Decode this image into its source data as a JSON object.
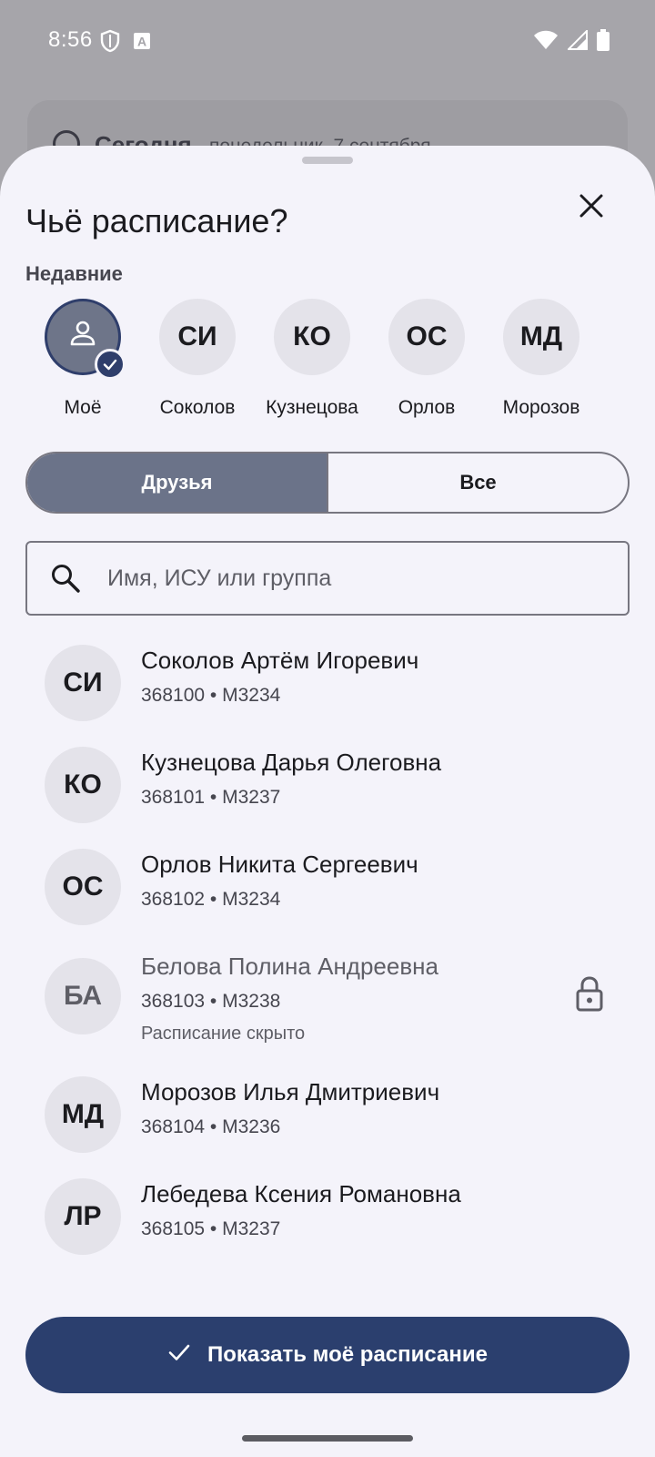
{
  "status_bar": {
    "time": "8:56",
    "icons": [
      "shield-icon",
      "font-a-icon",
      "wifi-icon",
      "signal-icon",
      "battery-icon"
    ]
  },
  "background": {
    "card_title": "Сегодня",
    "card_subtitle": "понедельник, 7 сентября"
  },
  "sheet": {
    "title": "Чьё расписание?",
    "close_icon": "close-icon",
    "recent_label": "Недавние",
    "recent": [
      {
        "initials": "",
        "name": "Моё",
        "selected": true,
        "icon": "person-icon"
      },
      {
        "initials": "СИ",
        "name": "Соколов",
        "selected": false
      },
      {
        "initials": "КО",
        "name": "Кузнецова",
        "selected": false
      },
      {
        "initials": "ОС",
        "name": "Орлов",
        "selected": false
      },
      {
        "initials": "МД",
        "name": "Морозов",
        "selected": false
      }
    ],
    "segments": {
      "friends": "Друзья",
      "all": "Все",
      "active": "friends"
    },
    "search": {
      "placeholder": "Имя, ИСУ или группа",
      "value": ""
    },
    "people": [
      {
        "initials": "СИ",
        "name": "Соколов Артём Игоревич",
        "meta": "368100 • M3234"
      },
      {
        "initials": "КО",
        "name": "Кузнецова Дарья Олеговна",
        "meta": "368101 • M3237"
      },
      {
        "initials": "ОС",
        "name": "Орлов Никита Сергеевич",
        "meta": "368102 • M3234"
      },
      {
        "initials": "БА",
        "name": "Белова Полина Андреевна",
        "meta": "368103 • M3238",
        "note": "Расписание скрыто",
        "locked": true
      },
      {
        "initials": "МД",
        "name": "Морозов Илья Дмитриевич",
        "meta": "368104 • M3236"
      },
      {
        "initials": "ЛР",
        "name": "Лебедева Ксения Романовна",
        "meta": "368105 • M3237"
      }
    ],
    "primary_button": "Показать моё расписание"
  },
  "colors": {
    "accent": "#2b3f6e",
    "segment_active": "#6b7389",
    "sheet_bg": "#f4f3fa",
    "avatar_bg": "#e4e3ea"
  }
}
